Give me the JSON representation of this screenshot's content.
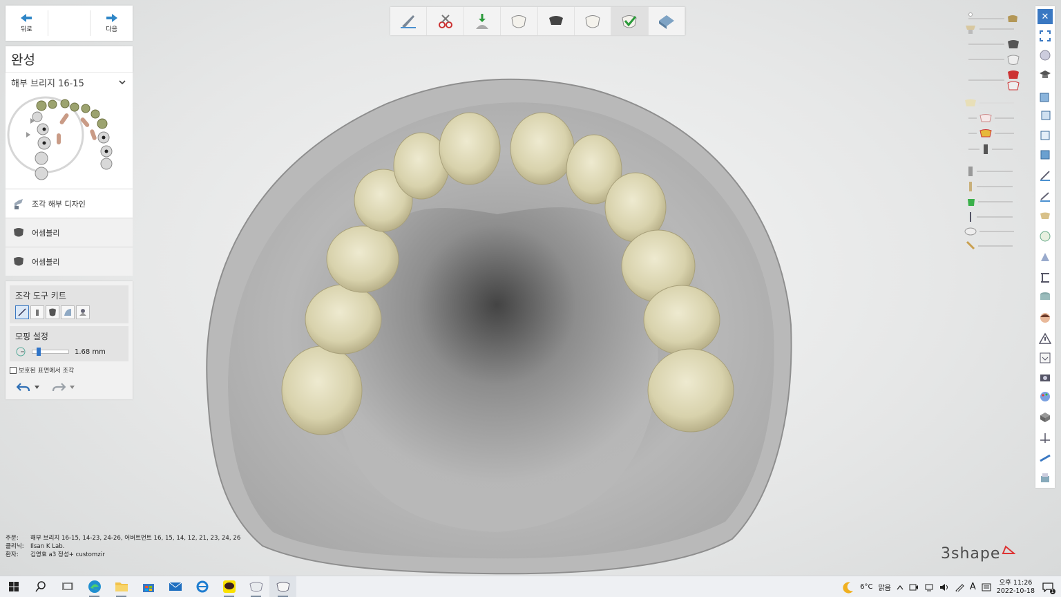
{
  "nav": {
    "back_label": "뒤로",
    "next_label": "다음"
  },
  "finish": {
    "title": "완성",
    "bridge_selector": "해부 브리지 16-15"
  },
  "steps": [
    {
      "label": "조각 해부 디자인"
    },
    {
      "label": "어셈블리"
    },
    {
      "label": "어셈블리"
    }
  ],
  "sculpt": {
    "toolkit_title": "조각 도구 키트",
    "morph_title": "모핑 설정",
    "morph_value": "1.68 mm",
    "morph_value_fraction": 0.12,
    "protected_label": "보호된 표면에서 조각"
  },
  "order_info": {
    "order_label": "주문:",
    "order_value": "해부 브리지 16-15, 14-23, 24-26, 어버트먼트 16, 15, 14, 12, 21, 23, 24, 26",
    "clinic_label": "클리닉:",
    "clinic_value": "Ilsan K Lab.",
    "patient_label": "환자:",
    "patient_value": "김영효 a3 정성+ customzir"
  },
  "brand": {
    "name": "3shape"
  },
  "taskbar": {
    "weather_temp": "6°C",
    "weather_text": "맑음",
    "ime": "A",
    "time": "오후 11:26",
    "date": "2022-10-18",
    "notif_count": "1"
  },
  "colors": {
    "accent": "#3a78c2",
    "tooth": "#ddd8b6",
    "model": "#a9a9a9"
  }
}
